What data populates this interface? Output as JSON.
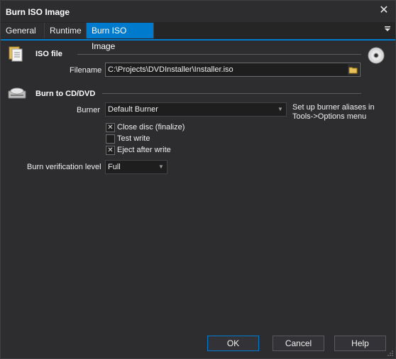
{
  "window": {
    "title": "Burn ISO Image"
  },
  "tabs": [
    {
      "label": "General"
    },
    {
      "label": "Runtime"
    },
    {
      "label": "Burn ISO Image",
      "active": true
    }
  ],
  "iso_section": {
    "title": "ISO file",
    "filename_label": "Filename",
    "filename_value": "C:\\Projects\\DVDInstaller\\Installer.iso"
  },
  "burn_section": {
    "title": "Burn to CD/DVD",
    "burner_label": "Burner",
    "burner_value": "Default Burner",
    "burner_hint": "Set up burner aliases in Tools->Options menu",
    "options": [
      {
        "label": "Close disc (finalize)",
        "checked": true
      },
      {
        "label": "Test write",
        "checked": false
      },
      {
        "label": "Eject after write",
        "checked": true
      }
    ],
    "verification_label": "Burn verification level",
    "verification_value": "Full"
  },
  "buttons": {
    "ok": "OK",
    "cancel": "Cancel",
    "help": "Help"
  },
  "colors": {
    "accent": "#007acc",
    "background": "#2d2d30",
    "field": "#1e1e1e"
  },
  "icons": [
    "close-icon",
    "tab-menu-icon",
    "iso-file-icon",
    "disc-icon",
    "cd-drive-icon",
    "folder-icon",
    "dropdown-arrow-icon",
    "check-icon"
  ]
}
